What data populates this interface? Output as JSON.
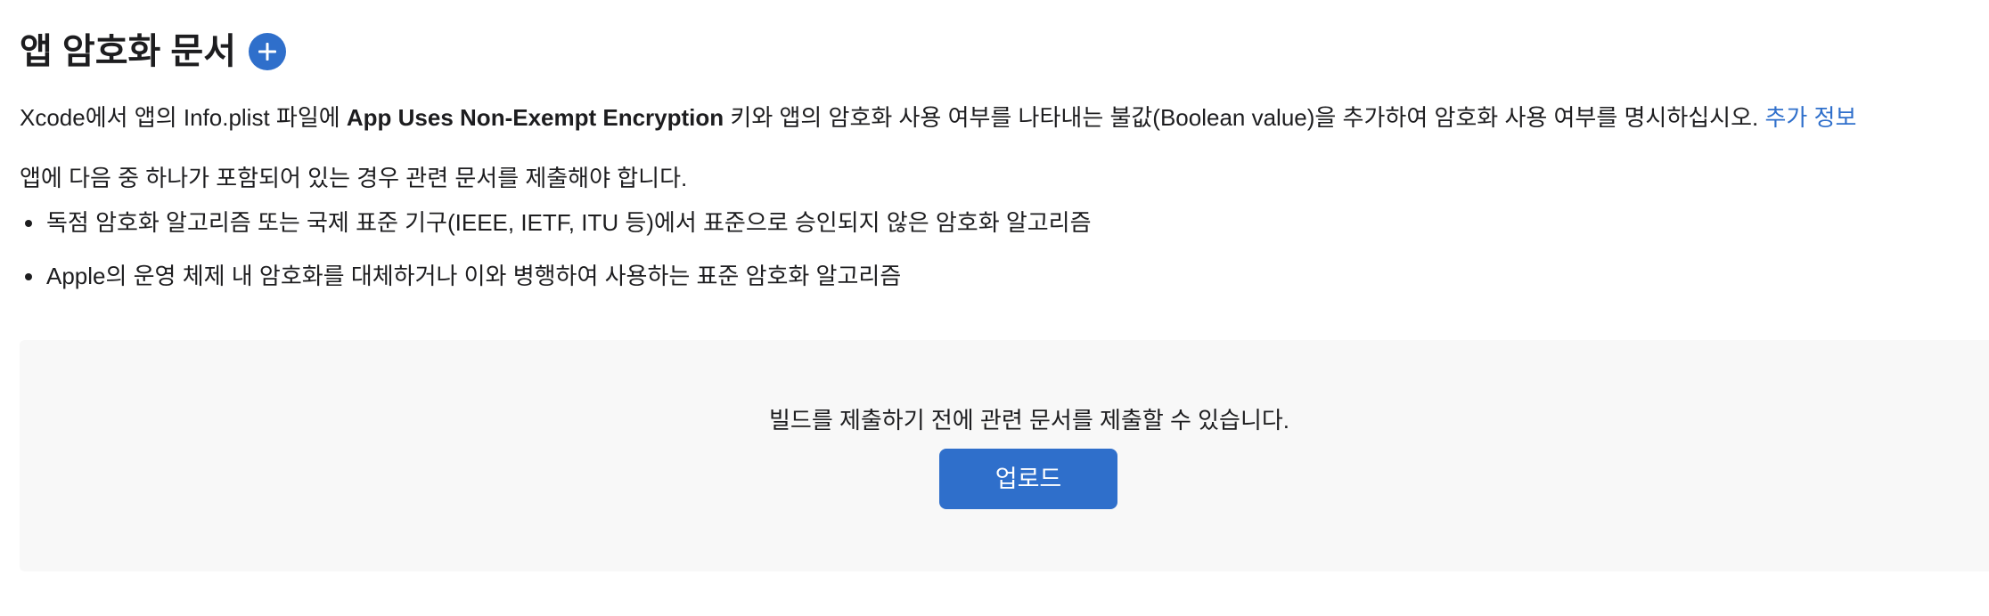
{
  "header": {
    "title": "앱 암호화 문서",
    "add_icon": "plus-circle-icon"
  },
  "intro": {
    "prefix": "Xcode에서 앱의 Info.plist 파일에 ",
    "key_name": "App Uses Non-Exempt Encryption",
    "suffix": " 키와 앱의 암호화 사용 여부를 나타내는 불값(Boolean value)을 추가하여 암호화 사용 여부를 명시하십시오. ",
    "link_label": "추가 정보"
  },
  "requirement": "앱에 다음 중 하나가 포함되어 있는 경우 관련 문서를 제출해야 합니다.",
  "bullets": [
    "독점 암호화 알고리즘 또는 국제 표준 기구(IEEE, IETF, ITU 등)에서 표준으로 승인되지 않은 암호화 알고리즘",
    "Apple의 운영 체제 내 암호화를 대체하거나 이와 병행하여 사용하는 표준 암호화 알고리즘"
  ],
  "upload": {
    "message": "빌드를 제출하기 전에 관련 문서를 제출할 수 있습니다.",
    "button_label": "업로드"
  },
  "colors": {
    "accent": "#2f6fcb",
    "text": "#1d1d1f",
    "panel_background": "#f8f8f8"
  }
}
